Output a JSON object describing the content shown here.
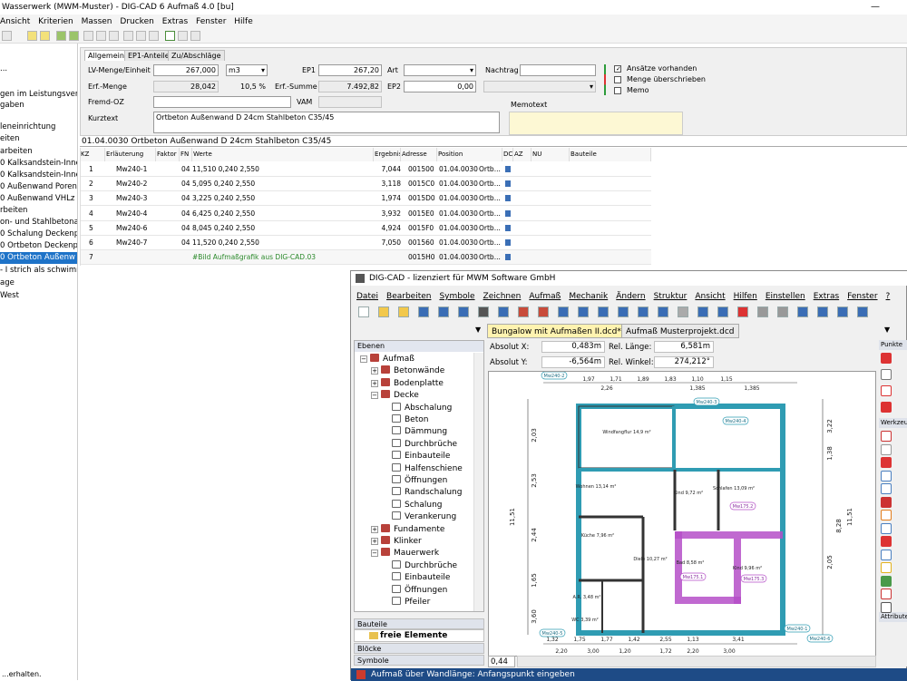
{
  "app": {
    "title": "Wasserwerk (MWM-Muster) - DIG-CAD 6 Aufmaß 4.0 [bu]",
    "menu": [
      "Ansicht",
      "Kriterien",
      "Massen",
      "Drucken",
      "Extras",
      "Fenster",
      "Hilfe"
    ],
    "status": "...erhalten."
  },
  "left_tree": [
    {
      "text": "..."
    },
    {
      "text": "gen im Leistungsverze"
    },
    {
      "text": "gaben"
    },
    {
      "text": ""
    },
    {
      "text": "leneinrichtung"
    },
    {
      "text": "eiten"
    },
    {
      "text": "arbeiten"
    },
    {
      "text": "0  Kalksandstein-Inne"
    },
    {
      "text": "0  Kalksandstein-Inne"
    },
    {
      "text": "0  Außenwand Poren"
    },
    {
      "text": "0  Außenwand VHLz"
    },
    {
      "text": "rbeiten"
    },
    {
      "text": "on- und Stahlbetonart"
    },
    {
      "text": "0  Schalung Deckenp"
    },
    {
      "text": "0  Ortbeton Deckenp"
    },
    {
      "text": "0  Ortbeton Außenw",
      "selected": true
    },
    {
      "text": "- I strich als schwimr"
    },
    {
      "text": "age"
    },
    {
      "text": "West"
    }
  ],
  "form": {
    "tabs": [
      "Allgemein",
      "EP1-Anteile",
      "Zu/Abschläge"
    ],
    "lv_menge_label": "LV-Menge/Einheit",
    "lv_menge": "267,000",
    "einheit": "m3",
    "ep1_label": "EP1",
    "ep1": "267,20",
    "art_label": "Art",
    "art": "",
    "nachtrag_label": "Nachtrag",
    "nachtrag": "",
    "erf_menge_label": "Erf.-Menge",
    "erf_menge": "28,042",
    "erf_pct": "10,5 %",
    "erf_summe_label": "Erf.-Summe",
    "erf_summe": "7.492,82",
    "ep2_label": "EP2",
    "ep2": "0,00",
    "fremd_oz_label": "Fremd-OZ",
    "vam_label": "VAM",
    "kurztext_label": "Kurztext",
    "kurztext": "Ortbeton Außenwand D 24cm Stahlbeton C35/45",
    "memotext_label": "Memotext",
    "checks": [
      "Ansätze vorhanden",
      "Menge überschrieben",
      "Memo"
    ],
    "checks_state": [
      true,
      false,
      false
    ]
  },
  "item_header": "01.04.0030  Ortbeton Außenwand D 24cm Stahlbeton C35/45",
  "grid": {
    "headers": [
      "KZ",
      "Erläuterung",
      "Faktor",
      "FN",
      "Werte",
      "Ergebnis",
      "Adresse",
      "Position",
      "DC",
      "AZ",
      "NU",
      "Bauteile"
    ],
    "rows": [
      [
        "1",
        "Mw240-1",
        "",
        "04",
        "11,510 0,240 2,550",
        "7,044",
        "001500",
        "01.04.0030",
        "Ortb..."
      ],
      [
        "2",
        "Mw240-2",
        "",
        "04",
        "5,095 0,240 2,550",
        "3,118",
        "0015C0",
        "01.04.0030",
        "Ortb..."
      ],
      [
        "3",
        "Mw240-3",
        "",
        "04",
        "3,225 0,240 2,550",
        "1,974",
        "0015D0",
        "01.04.0030",
        "Ortb..."
      ],
      [
        "4",
        "Mw240-4",
        "",
        "04",
        "6,425 0,240 2,550",
        "3,932",
        "0015E0",
        "01.04.0030",
        "Ortb..."
      ],
      [
        "5",
        "Mw240-6",
        "",
        "04",
        "8,045 0,240 2,550",
        "4,924",
        "0015F0",
        "01.04.0030",
        "Ortb..."
      ],
      [
        "6",
        "Mw240-7",
        "",
        "04",
        "11,520 0,240 2,550",
        "7,050",
        "001560",
        "01.04.0030",
        "Ortb..."
      ],
      [
        "7",
        "",
        "",
        "",
        "#Bild Aufmaßgrafik aus DIG-CAD.03",
        "",
        "0015H0",
        "01.04.0030",
        "Ortb..."
      ]
    ]
  },
  "cad": {
    "title": "DIG-CAD - lizenziert für MWM Software GmbH",
    "menu": [
      "Datei",
      "Bearbeiten",
      "Symbole",
      "Zeichnen",
      "Aufmaß",
      "Mechanik",
      "Ändern",
      "Struktur",
      "Ansicht",
      "Hilfen",
      "Einstellen",
      "Extras",
      "Fenster",
      "?"
    ],
    "doc_tabs": [
      "Bungalow mit Aufmaßen II.dcd*",
      "Aufmaß Musterprojekt.dcd"
    ],
    "layers_header": "Ebenen",
    "layers": [
      {
        "t": "Aufmaß",
        "lvl": 0,
        "exp": "−",
        "ic": "red"
      },
      {
        "t": "Betonwände",
        "lvl": 1,
        "exp": "+",
        "ic": "red"
      },
      {
        "t": "Bodenplatte",
        "lvl": 1,
        "exp": "+",
        "ic": "red"
      },
      {
        "t": "Decke",
        "lvl": 1,
        "exp": "−",
        "ic": "red"
      },
      {
        "t": "Abschalung",
        "lvl": 2,
        "exp": "",
        "ic": "page"
      },
      {
        "t": "Beton",
        "lvl": 2,
        "exp": "",
        "ic": "page"
      },
      {
        "t": "Dämmung",
        "lvl": 2,
        "exp": "",
        "ic": "page"
      },
      {
        "t": "Durchbrüche",
        "lvl": 2,
        "exp": "",
        "ic": "page"
      },
      {
        "t": "Einbauteile",
        "lvl": 2,
        "exp": "",
        "ic": "page"
      },
      {
        "t": "Halfenschiene",
        "lvl": 2,
        "exp": "",
        "ic": "page"
      },
      {
        "t": "Öffnungen",
        "lvl": 2,
        "exp": "",
        "ic": "page"
      },
      {
        "t": "Randschalung",
        "lvl": 2,
        "exp": "",
        "ic": "page"
      },
      {
        "t": "Schalung",
        "lvl": 2,
        "exp": "",
        "ic": "page"
      },
      {
        "t": "Verankerung",
        "lvl": 2,
        "exp": "",
        "ic": "page"
      },
      {
        "t": "Fundamente",
        "lvl": 1,
        "exp": "+",
        "ic": "red"
      },
      {
        "t": "Klinker",
        "lvl": 1,
        "exp": "+",
        "ic": "red"
      },
      {
        "t": "Mauerwerk",
        "lvl": 1,
        "exp": "−",
        "ic": "red"
      },
      {
        "t": "Durchbrüche",
        "lvl": 2,
        "exp": "",
        "ic": "page"
      },
      {
        "t": "Einbauteile",
        "lvl": 2,
        "exp": "",
        "ic": "page"
      },
      {
        "t": "Öffnungen",
        "lvl": 2,
        "exp": "",
        "ic": "page"
      },
      {
        "t": "Pfeiler",
        "lvl": 2,
        "exp": "",
        "ic": "page"
      }
    ],
    "bauteile_header": "Bauteile",
    "bauteile_item": "freie Elemente",
    "bloecke_header": "Blöcke",
    "symbole_header": "Symbole",
    "abs_x_label": "Absolut X:",
    "abs_x": "0,483m",
    "abs_y_label": "Absolut Y:",
    "abs_y": "-6,564m",
    "rel_len_label": "Rel. Länge:",
    "rel_len": "6,581m",
    "rel_win_label": "Rel. Winkel:",
    "rel_win": "274,212°",
    "zoom": "0,44",
    "status": "Aufmaß über Wandlänge: Anfangspunkt eingeben",
    "right_headers": [
      "Punkte",
      "Werkzeuge",
      "Attribute"
    ],
    "rooms": [
      "Windfangflur 14,9 m²",
      "Wohnen 13,14 m²",
      "Kind 9,72 m²",
      "Schlafen 13,09 m²",
      "Küche 7,96 m²",
      "Diele 10,27 m²",
      "Bad 8,58 m²",
      "Kind 9,96 m²",
      "A.R. 3,48 m²",
      "WC 3,39 m²"
    ],
    "dims_top": [
      "1,97",
      "1,71",
      "1,89",
      "1,83",
      "1,10",
      "1,15",
      "2,26",
      "1,385",
      "1,385"
    ],
    "dims_bottom": [
      "1,32",
      "1,75",
      "1,77",
      "1,42",
      "2,55",
      "1,13",
      "3,41",
      "2,20",
      "3,00",
      "1,20",
      "1,72",
      "2,20",
      "3,00"
    ],
    "dims_left": [
      "11,51",
      "2,03",
      "2,53",
      "2,44",
      "1,65",
      "3,60"
    ],
    "dims_right": [
      "11,51",
      "3,22",
      "8,28",
      "1,38",
      "2,05"
    ],
    "tags": [
      "Mw240-2",
      "Mw240-3",
      "Mw240-4",
      "Mw175.2",
      "Mw175.3",
      "Mw175.1",
      "Mw240-5",
      "Mw240-6",
      "Mw240-1"
    ]
  }
}
